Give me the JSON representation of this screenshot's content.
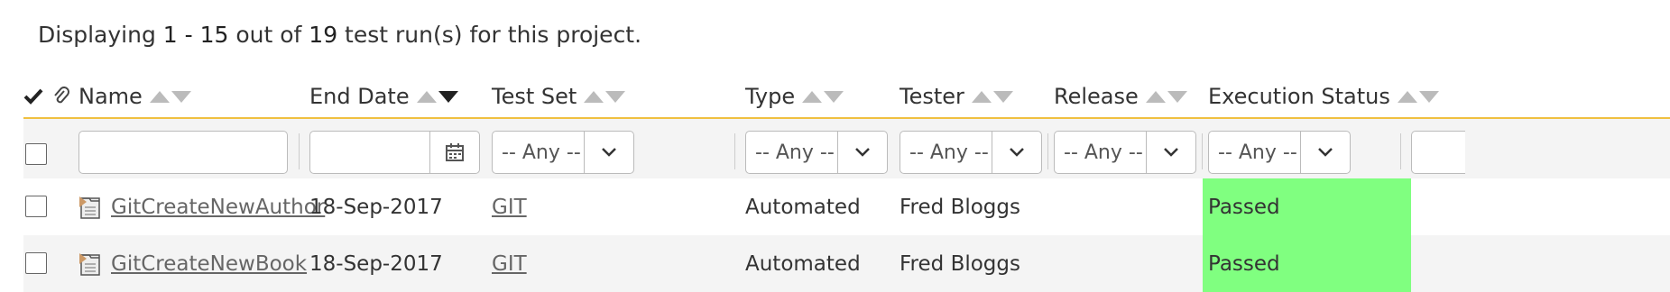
{
  "summary": {
    "prefix": "Displaying ",
    "range": "1 - 15",
    "mid": " out of ",
    "total": "19",
    "suffix": " test run(s) for this project."
  },
  "columns": {
    "name": "Name",
    "end_date": "End Date",
    "test_set": "Test Set",
    "type": "Type",
    "tester": "Tester",
    "release": "Release",
    "execution_status": "Execution Status"
  },
  "filters": {
    "name_value": "",
    "end_date_value": "",
    "test_set": "-- Any --",
    "type": "-- Any --",
    "tester": "-- Any --",
    "release": "-- Any --",
    "execution_status": "-- Any --"
  },
  "rows": [
    {
      "name": "GitCreateNewAuthor",
      "end_date": "18-Sep-2017",
      "test_set": "GIT",
      "type": "Automated",
      "tester": "Fred Bloggs",
      "release": "",
      "execution_status": "Passed"
    },
    {
      "name": "GitCreateNewBook",
      "end_date": "18-Sep-2017",
      "test_set": "GIT",
      "type": "Automated",
      "tester": "Fred Bloggs",
      "release": "",
      "execution_status": "Passed"
    }
  ],
  "colors": {
    "header_underline": "#f0c040",
    "passed": "#80ff80"
  },
  "icons": {
    "select_all": "checkmark-icon",
    "attachment": "paperclip-icon",
    "calendar": "calendar-icon",
    "dropdown": "chevron-down-icon",
    "test_run": "test-run-file-icon"
  }
}
